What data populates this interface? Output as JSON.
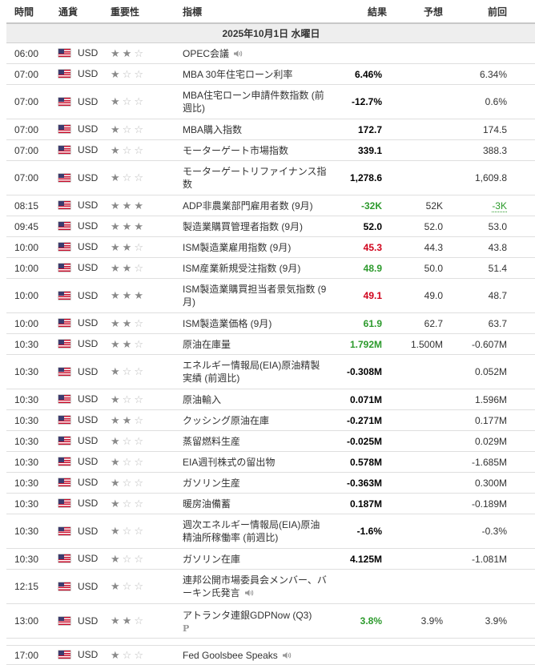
{
  "headers": {
    "time": "時間",
    "currency": "通貨",
    "importance": "重要性",
    "event": "指標",
    "actual": "結果",
    "forecast": "予想",
    "previous": "前回"
  },
  "date_label": "2025年10月1日 水曜日",
  "icons": {
    "flag": "us-flag-icon",
    "star": "star-icon",
    "speaker": "speaker-icon",
    "preliminary": "p-icon"
  },
  "colors": {
    "positive": "#2c9a2c",
    "negative": "#d0021b",
    "star_on": "#8a8a8a",
    "star_off": "#bdbdbd"
  },
  "rows": [
    {
      "time": "06:00",
      "currency": "USD",
      "importance": 2,
      "event": "OPEC会議",
      "speaker": true,
      "actual": "",
      "forecast": "",
      "previous": "",
      "h": 26
    },
    {
      "time": "07:00",
      "currency": "USD",
      "importance": 1,
      "event": "MBA 30年住宅ローン利率",
      "actual": "6.46%",
      "forecast": "",
      "previous": "6.34%",
      "h": 26
    },
    {
      "time": "07:00",
      "currency": "USD",
      "importance": 1,
      "event": "MBA住宅ローン申請件数指数 (前週比)",
      "actual": "-12.7%",
      "forecast": "",
      "previous": "0.6%",
      "h": 43
    },
    {
      "time": "07:00",
      "currency": "USD",
      "importance": 1,
      "event": "MBA購入指数",
      "actual": "172.7",
      "forecast": "",
      "previous": "174.5",
      "h": 26
    },
    {
      "time": "07:00",
      "currency": "USD",
      "importance": 1,
      "event": "モーターゲート市場指数",
      "actual": "339.1",
      "forecast": "",
      "previous": "388.3",
      "h": 26
    },
    {
      "time": "07:00",
      "currency": "USD",
      "importance": 1,
      "event": "モーターゲートリファイナンス指数",
      "actual": "1,278.6",
      "forecast": "",
      "previous": "1,609.8",
      "h": 43
    },
    {
      "time": "08:15",
      "currency": "USD",
      "importance": 3,
      "event": "ADP非農業部門雇用者数 (9月)",
      "actual": "-32K",
      "actual_color": "green",
      "forecast": "52K",
      "previous": "-3K",
      "previous_color": "green",
      "h": 26
    },
    {
      "time": "09:45",
      "currency": "USD",
      "importance": 3,
      "event": "製造業購買管理者指数 (9月)",
      "actual": "52.0",
      "forecast": "52.0",
      "previous": "53.0",
      "h": 26
    },
    {
      "time": "10:00",
      "currency": "USD",
      "importance": 2,
      "event": "ISM製造業雇用指数 (9月)",
      "actual": "45.3",
      "actual_color": "red",
      "forecast": "44.3",
      "previous": "43.8",
      "h": 26
    },
    {
      "time": "10:00",
      "currency": "USD",
      "importance": 2,
      "event": "ISM産業新規受注指数 (9月)",
      "actual": "48.9",
      "actual_color": "green",
      "forecast": "50.0",
      "previous": "51.4",
      "h": 26
    },
    {
      "time": "10:00",
      "currency": "USD",
      "importance": 3,
      "event": "ISM製造業購買担当者景気指数 (9月)",
      "actual": "49.1",
      "actual_color": "red",
      "forecast": "49.0",
      "previous": "48.7",
      "h": 43
    },
    {
      "time": "10:00",
      "currency": "USD",
      "importance": 2,
      "event": "ISM製造業価格 (9月)",
      "actual": "61.9",
      "actual_color": "green",
      "forecast": "62.7",
      "previous": "63.7",
      "h": 26
    },
    {
      "time": "10:30",
      "currency": "USD",
      "importance": 2,
      "event": "原油在庫量",
      "actual": "1.792M",
      "actual_color": "green",
      "forecast": "1.500M",
      "previous": "-0.607M",
      "h": 26
    },
    {
      "time": "10:30",
      "currency": "USD",
      "importance": 1,
      "event": "エネルギー情報局(EIA)原油精製実績 (前週比)",
      "actual": "-0.308M",
      "forecast": "",
      "previous": "0.052M",
      "h": 43
    },
    {
      "time": "10:30",
      "currency": "USD",
      "importance": 1,
      "event": "原油輸入",
      "actual": "0.071M",
      "forecast": "",
      "previous": "1.596M",
      "h": 26
    },
    {
      "time": "10:30",
      "currency": "USD",
      "importance": 2,
      "event": "クッシング原油在庫",
      "actual": "-0.271M",
      "forecast": "",
      "previous": "0.177M",
      "h": 26
    },
    {
      "time": "10:30",
      "currency": "USD",
      "importance": 1,
      "event": "蒸留燃料生産",
      "actual": "-0.025M",
      "forecast": "",
      "previous": "0.029M",
      "h": 26
    },
    {
      "time": "10:30",
      "currency": "USD",
      "importance": 1,
      "event": "EIA週刊株式の留出物",
      "actual": "0.578M",
      "forecast": "",
      "previous": "-1.685M",
      "h": 26
    },
    {
      "time": "10:30",
      "currency": "USD",
      "importance": 1,
      "event": "ガソリン生産",
      "actual": "-0.363M",
      "forecast": "",
      "previous": "0.300M",
      "h": 26
    },
    {
      "time": "10:30",
      "currency": "USD",
      "importance": 1,
      "event": "暖房油備蓄",
      "actual": "0.187M",
      "forecast": "",
      "previous": "-0.189M",
      "h": 26
    },
    {
      "time": "10:30",
      "currency": "USD",
      "importance": 1,
      "event": "週次エネルギー情報局(EIA)原油精油所稼働率 (前週比)",
      "actual": "-1.6%",
      "forecast": "",
      "previous": "-0.3%",
      "h": 43
    },
    {
      "time": "10:30",
      "currency": "USD",
      "importance": 1,
      "event": "ガソリン在庫",
      "actual": "4.125M",
      "forecast": "",
      "previous": "-1.081M",
      "h": 26
    },
    {
      "time": "12:15",
      "currency": "USD",
      "importance": 1,
      "event": "連邦公開市場委員会メンバー、バーキン氏発言",
      "speaker": true,
      "actual": "",
      "forecast": "",
      "previous": "",
      "h": 43
    },
    {
      "time": "13:00",
      "currency": "USD",
      "importance": 2,
      "event": "アトランタ連銀GDPNow (Q3)",
      "preliminary": true,
      "preliminary_label": "P",
      "actual": "3.8%",
      "actual_color": "green",
      "forecast": "3.9%",
      "previous": "3.9%",
      "h": 43
    },
    {
      "gap": true,
      "h": 8
    },
    {
      "time": "17:00",
      "currency": "USD",
      "importance": 1,
      "event": "Fed Goolsbee Speaks",
      "speaker": true,
      "actual": "",
      "forecast": "",
      "previous": "",
      "h": 24
    }
  ]
}
